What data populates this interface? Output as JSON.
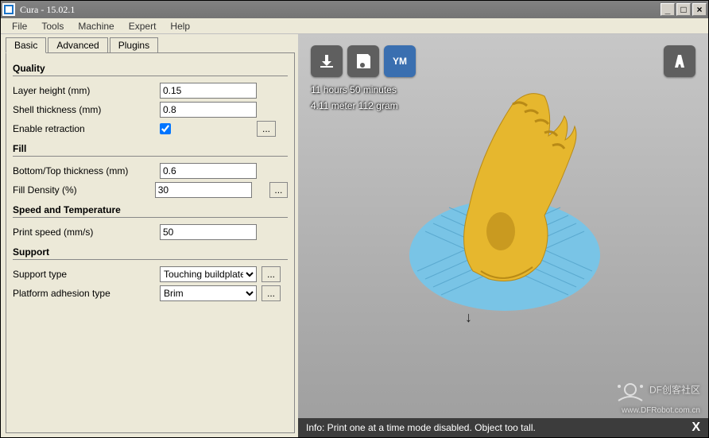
{
  "window": {
    "title": "Cura - 15.02.1",
    "buttons": {
      "min": "_",
      "max": "□",
      "close": "×"
    }
  },
  "menu": {
    "file": "File",
    "tools": "Tools",
    "machine": "Machine",
    "expert": "Expert",
    "help": "Help"
  },
  "tabs": {
    "basic": "Basic",
    "advanced": "Advanced",
    "plugins": "Plugins"
  },
  "sections": {
    "quality": {
      "title": "Quality",
      "layer_height_label": "Layer height (mm)",
      "layer_height_value": "0.15",
      "shell_thickness_label": "Shell thickness (mm)",
      "shell_thickness_value": "0.8",
      "enable_retraction_label": "Enable retraction",
      "dots": "..."
    },
    "fill": {
      "title": "Fill",
      "bottom_top_label": "Bottom/Top thickness (mm)",
      "bottom_top_value": "0.6",
      "fill_density_label": "Fill Density (%)",
      "fill_density_value": "30",
      "dots": "..."
    },
    "speed": {
      "title": "Speed and Temperature",
      "print_speed_label": "Print speed (mm/s)",
      "print_speed_value": "50"
    },
    "support": {
      "title": "Support",
      "support_type_label": "Support type",
      "support_type_value": "Touching buildplate",
      "platform_adhesion_label": "Platform adhesion type",
      "platform_adhesion_value": "Brim",
      "dots": "..."
    }
  },
  "viewport": {
    "time_line": "11 hours 50 minutes",
    "material_line": "4.11 meter 112 gram",
    "ym_label": "YM",
    "info_text": "Info: Print one at a time mode disabled. Object too tall.",
    "info_close": "X"
  },
  "watermark": {
    "line1": "DF创客社区",
    "line2": "www.DFRobot.com.cn"
  }
}
